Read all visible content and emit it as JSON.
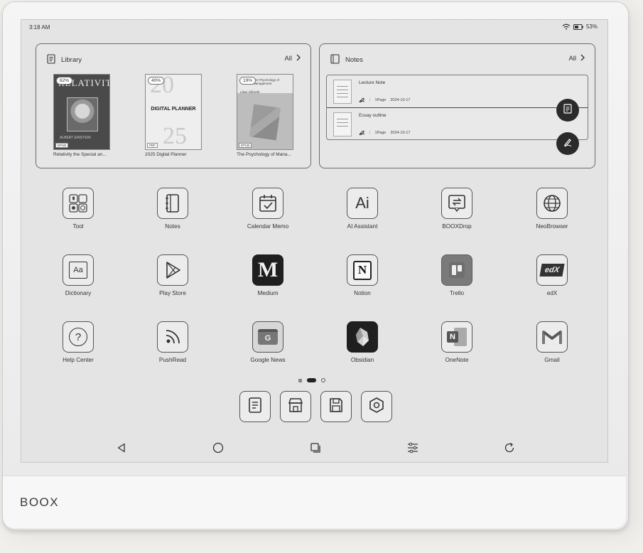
{
  "brand": "BOOX",
  "status": {
    "time": "3:18 AM",
    "battery": "53%"
  },
  "library": {
    "title": "Library",
    "all_label": "All",
    "books": [
      {
        "title": "Relativity the Special an...",
        "progress": "62%",
        "format": "EPUB",
        "cover_title": "RELATIVITY",
        "cover_author": "ALBERT EINSTEIN"
      },
      {
        "title": "2025 Digital Planner",
        "progress": "40%",
        "format": "PDF",
        "cover_top": "20",
        "cover_mid": "DIGITAL PLANNER",
        "cover_bottom": "25"
      },
      {
        "title": "The Psychology of Mana...",
        "progress": "19%",
        "format": "EPUB",
        "cover_line1": "The Psychology of Management",
        "cover_line2": "Lilian Gilbreth"
      }
    ]
  },
  "notes": {
    "title": "Notes",
    "all_label": "All",
    "items": [
      {
        "title": "Lecture Note",
        "pages": "1Page",
        "date": "2024-10-17"
      },
      {
        "title": "Essay outline",
        "pages": "1Page",
        "date": "2024-10-17"
      }
    ]
  },
  "apps": [
    {
      "label": "Tool",
      "icon": "tool-grid-icon"
    },
    {
      "label": "Notes",
      "icon": "notebook-icon"
    },
    {
      "label": "Calendar Memo",
      "icon": "calendar-check-icon"
    },
    {
      "label": "AI Assistant",
      "icon": "ai-text-icon",
      "glyph": "Ai"
    },
    {
      "label": "BOOXDrop",
      "icon": "transfer-arrows-icon"
    },
    {
      "label": "NeoBrowser",
      "icon": "globe-icon"
    },
    {
      "label": "Dictionary",
      "icon": "dictionary-icon",
      "glyph": "Aa"
    },
    {
      "label": "Play Store",
      "icon": "play-triangle-icon"
    },
    {
      "label": "Medium",
      "icon": "medium-logo-icon",
      "glyph": "M"
    },
    {
      "label": "Notion",
      "icon": "notion-logo-icon",
      "glyph": "N"
    },
    {
      "label": "Trello",
      "icon": "trello-logo-icon"
    },
    {
      "label": "edX",
      "icon": "edx-logo-icon",
      "glyph": "edX"
    },
    {
      "label": "Help Center",
      "icon": "help-question-icon",
      "glyph": "?"
    },
    {
      "label": "PushRead",
      "icon": "rss-feed-icon"
    },
    {
      "label": "Google News",
      "icon": "google-news-icon",
      "glyph": "G"
    },
    {
      "label": "Obsidian",
      "icon": "obsidian-logo-icon"
    },
    {
      "label": "OneNote",
      "icon": "onenote-logo-icon",
      "glyph": "N"
    },
    {
      "label": "Gmail",
      "icon": "gmail-logo-icon",
      "glyph": "M"
    }
  ],
  "dock": [
    "document-icon",
    "store-icon",
    "save-disk-icon",
    "settings-hex-icon"
  ],
  "nav": [
    "back-icon",
    "home-icon",
    "recents-icon",
    "adjust-sliders-icon",
    "refresh-icon"
  ]
}
